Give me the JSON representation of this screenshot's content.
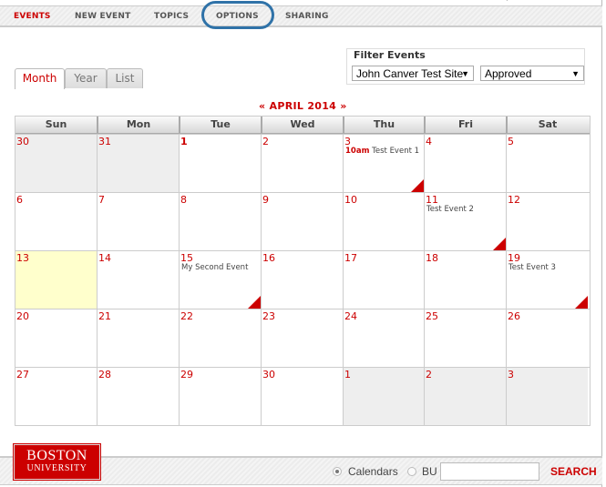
{
  "nav": {
    "items": [
      {
        "label": "EVENTS",
        "active": true
      },
      {
        "label": "NEW EVENT",
        "active": false
      },
      {
        "label": "TOPICS",
        "active": false
      },
      {
        "label": "OPTIONS",
        "active": false,
        "highlighted": true
      },
      {
        "label": "SHARING",
        "active": false
      }
    ]
  },
  "filter": {
    "title": "Filter Events",
    "site_value": "John Canver Test Site",
    "status_value": "Approved"
  },
  "view_tabs": [
    {
      "label": "Month",
      "active": true
    },
    {
      "label": "Year",
      "active": false
    },
    {
      "label": "List",
      "active": false
    }
  ],
  "calendar": {
    "prev": "«",
    "title": "APRIL 2014",
    "next": "»",
    "weekdays": [
      "Sun",
      "Mon",
      "Tue",
      "Wed",
      "Thu",
      "Fri",
      "Sat"
    ],
    "weeks": [
      [
        {
          "day": "30",
          "other": true
        },
        {
          "day": "31",
          "other": true
        },
        {
          "day": "1",
          "bold": true
        },
        {
          "day": "2"
        },
        {
          "day": "3",
          "event_time": "10am",
          "event": "Test Event 1",
          "flag": true
        },
        {
          "day": "4"
        },
        {
          "day": "5"
        }
      ],
      [
        {
          "day": "6"
        },
        {
          "day": "7"
        },
        {
          "day": "8"
        },
        {
          "day": "9"
        },
        {
          "day": "10"
        },
        {
          "day": "11",
          "event": "Test Event 2",
          "flag": true
        },
        {
          "day": "12"
        }
      ],
      [
        {
          "day": "13",
          "today": true
        },
        {
          "day": "14"
        },
        {
          "day": "15",
          "event": "My Second Event",
          "flag": true
        },
        {
          "day": "16"
        },
        {
          "day": "17"
        },
        {
          "day": "18"
        },
        {
          "day": "19",
          "event": "Test Event 3",
          "flag": true
        }
      ],
      [
        {
          "day": "20"
        },
        {
          "day": "21"
        },
        {
          "day": "22"
        },
        {
          "day": "23"
        },
        {
          "day": "24"
        },
        {
          "day": "25"
        },
        {
          "day": "26"
        }
      ],
      [
        {
          "day": "27"
        },
        {
          "day": "28"
        },
        {
          "day": "29"
        },
        {
          "day": "30"
        },
        {
          "day": "1",
          "other": true
        },
        {
          "day": "2",
          "other": true
        },
        {
          "day": "3",
          "other": true
        }
      ]
    ]
  },
  "logo": {
    "line1": "BOSTON",
    "line2": "UNIVERSITY"
  },
  "footer": {
    "radio_calendars": "Calendars",
    "radio_bu": "BU",
    "selected": "Calendars",
    "search_value": "",
    "search_label": "SEARCH"
  },
  "colors": {
    "accent": "#cc0000",
    "highlight_oval": "#2f72a8",
    "today": "#ffffcc"
  }
}
